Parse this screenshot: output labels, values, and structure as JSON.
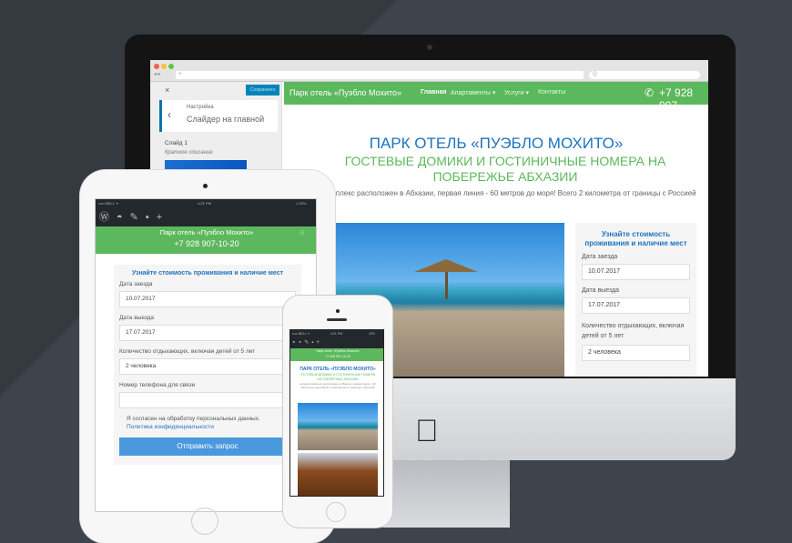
{
  "browser": {
    "url_placeholder": "+",
    "search_placeholder": "Q"
  },
  "customizer": {
    "close": "×",
    "save": "Сохранено",
    "back": "‹",
    "crumb": "Настройка",
    "section": "Слайдер на главной",
    "slide": "Слайд 1",
    "short_desc": "Краткое описание"
  },
  "site": {
    "brand": "Парк отель «Пуэбло Мохито»",
    "nav": [
      "Главная",
      "Апартаменты ▾",
      "Услуги ▾",
      "Контакты"
    ],
    "phone": "+7 928 907",
    "phone_full": "+7 928 907-10-20",
    "title": "ПАРК ОТЕЛЬ «ПУЭБЛО МОХИТО»",
    "subtitle": "ГОСТЕВЫЕ ДОМИКИ И ГОСТИНИЧНЫЕ НОМЕРА НА ПОБЕРЕЖЬЕ АБХАЗИИ",
    "lead": "ничный комплекс расположен в Абхазии, первая линия - 60 метров до моря! Всего 2 километра от границы с Россией",
    "colors": {
      "green": "#5cb85c",
      "blue": "#1e73be"
    }
  },
  "form": {
    "title": "Узнайте стоимость проживания и наличие мест",
    "checkin_label": "Дата заезда",
    "checkin": "10.07.2017",
    "checkout_label": "Дата выезда",
    "checkout": "17.07.2017",
    "guests_label": "Количество отдыхающих, включая детей от 5 лет",
    "guests": "2 человека",
    "phone_label": "Номер телефона для связи",
    "consent": "Я согласен на обработку персональных данных.",
    "privacy": "Политика конфиденциальности",
    "submit": "Отправить запрос"
  },
  "ipad": {
    "carrier": "••••• BELL ᯤ",
    "time": "4:21 PM",
    "battery": "1 22%"
  },
  "iphone": {
    "carrier": "••••• BELL ᯤ",
    "time": "4:21 PM",
    "battery": "22%"
  }
}
